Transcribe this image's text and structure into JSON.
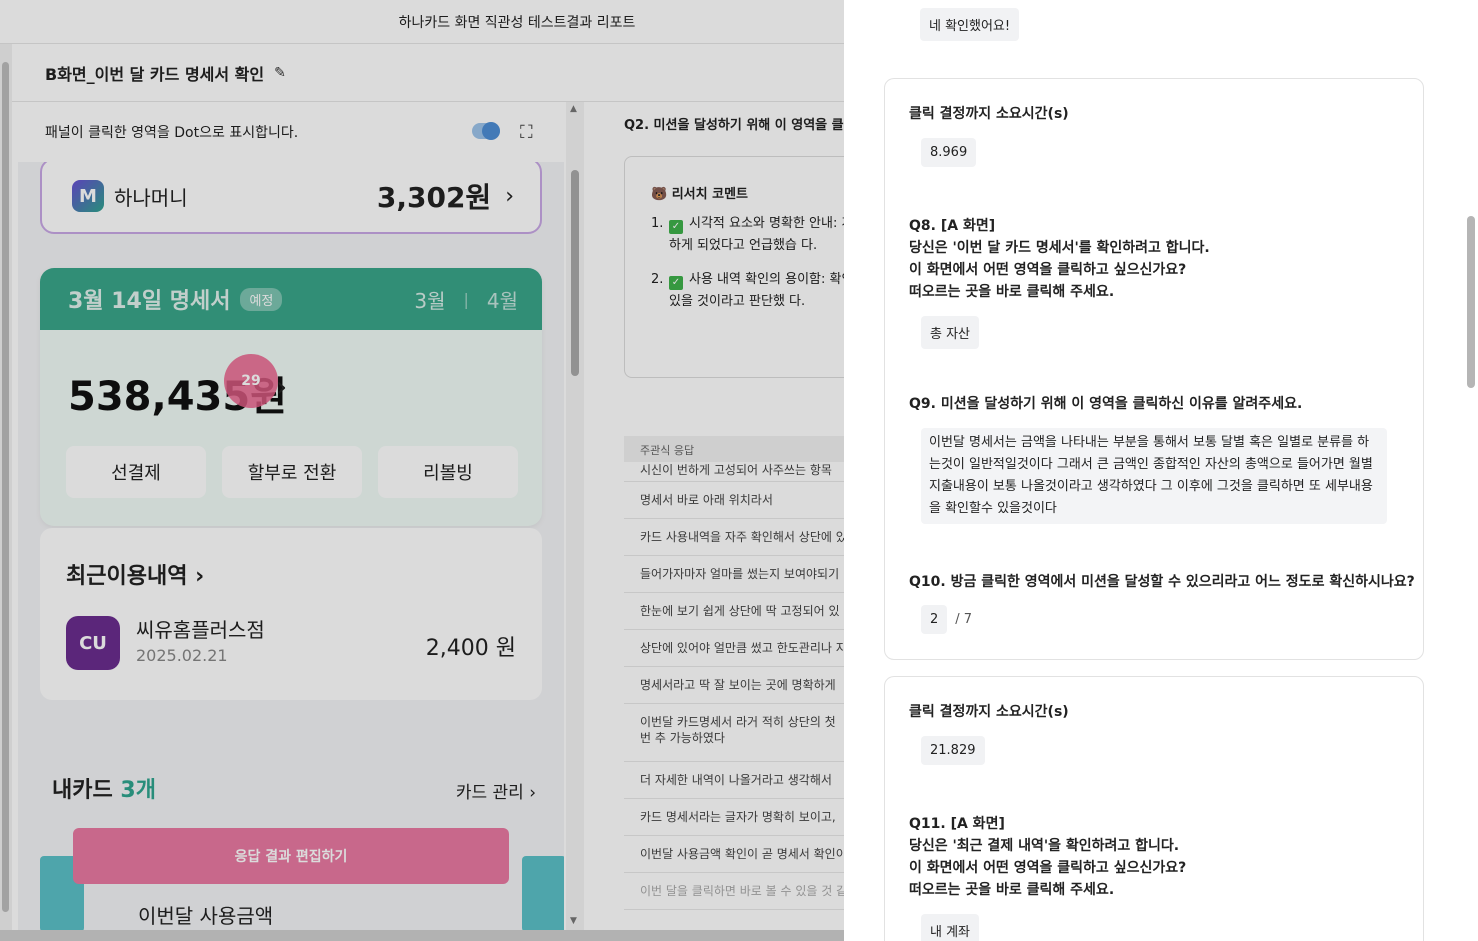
{
  "report_title": "하나카드 화면 직관성 테스트결과 리포트",
  "screen_title": "B화면_이번 달 카드 명세서 확인",
  "edit_icon_glyph": "✎",
  "left_panel": {
    "caption": "패널이 클릭한 영역을 Dot으로 표시합니다.",
    "expand_icon_glyph": "⛶",
    "phone": {
      "hanamoney_logo": "M",
      "hanamoney_label": "하나머니",
      "hanamoney_amount": "3,302원",
      "chevron": "›",
      "statement_date": "3월 14일 명세서",
      "statement_badge": "예정",
      "month_current": "3월",
      "month_sep": "|",
      "month_next": "4월",
      "statement_amount": "538,435원",
      "dot_count": "29",
      "buttons": [
        "선결제",
        "할부로 전환",
        "리볼빙"
      ],
      "recent_title": "최근이용내역 ›",
      "cu_logo": "CU",
      "store_name": "씨유홈플러스점",
      "store_date": "2025.02.21",
      "store_amount": "2,400 원",
      "mycards_label": "내카드",
      "mycards_count": "3개",
      "card_manage": "카드 관리 ›",
      "edit_button": "응답 결과 편집하기",
      "this_month_amount": "이번달 사용금액"
    }
  },
  "right_panel": {
    "question": "Q2. 미션을 달성하기 위해 이 영역을 클릭",
    "research_comment_title": "🐻 리서치 코멘트",
    "comments": [
      {
        "num": "1.",
        "text": "시각적 요소와 명확한 안내: 게 클릭하게 되었다고 언급했습 다."
      },
      {
        "num": "2.",
        "text": "사용 내역 확인의 용이함: 확인할 수 있을 것이라고 판단했 다."
      }
    ],
    "answer_header": "주관식 응답",
    "answers": [
      "시신이 번하게 고성되어 사주쓰는 항목",
      "명세서 바로 아래 위치라서",
      "카드 사용내역을 자주 확인해서 상단에 있",
      "들어가자마자 얼마를 썼는지 보여야되기",
      "한눈에 보기 쉽게 상단에 딱 고정되어 있",
      "상단에 있어야 얼만큼 썼고 한도관리나 지",
      "명세서라고 딱 잘 보이는 곳에 명확하게 ",
      "이번달 카드명세서 라거 적히 상단의 첫번 추 가능하였다",
      "더 자세한 내역이 나올거라고 생각해서",
      "카드 명세서라는 글자가 명확히 보이고, ",
      "이번달 사용금액 확인이 곧 명세서 확인이",
      "이번 달을 클릭하면 바로 볼 수 있을 것 같"
    ]
  },
  "drawer": {
    "top_answer": "네 확인했어요!",
    "card1": {
      "time_label": "클릭 결정까지 소요시간(s)",
      "time_value": "8.969",
      "q8_line1": "Q8. [A 화면]",
      "q8_line2": "당신은 '이번 달 카드 명세서'를 확인하려고 합니다.",
      "q8_line3": "이 화면에서 어떤 영역을 클릭하고 싶으신가요?",
      "q8_line4": "떠오르는 곳을 바로 클릭해 주세요.",
      "q8_answer": "총 자산",
      "q9_title": "Q9. 미션을 달성하기 위해 이 영역을 클릭하신 이유를 알려주세요.",
      "q9_answer": "이번달 명세서는 금액을 나타내는 부분을 통해서 보통 달별 혹은 일별로 분류를 하는것이 일반적일것이다 그래서 큰 금액인 종합적인 자산의 총액으로 들어가면 월별 지출내용이 보통 나올것이라고 생각하였다 그 이후에 그것을 클릭하면 또 세부내용을 확인할수 있을것이다",
      "q10_title": "Q10. 방금 클릭한 영역에서 미션을 달성할 수 있으리라고 어느 정도로 확신하시나요?",
      "q10_value": "2",
      "q10_scale": "/ 7"
    },
    "card2": {
      "time_label": "클릭 결정까지 소요시간(s)",
      "time_value": "21.829",
      "q11_line1": "Q11. [A 화면]",
      "q11_line2": "당신은 '최근 결제 내역'을 확인하려고 합니다.",
      "q11_line3": "이 화면에서 어떤 영역을 클릭하고 싶으신가요?",
      "q11_line4": "떠오르는 곳을 바로 클릭해 주세요.",
      "q11_answer": "내 계좌"
    }
  }
}
